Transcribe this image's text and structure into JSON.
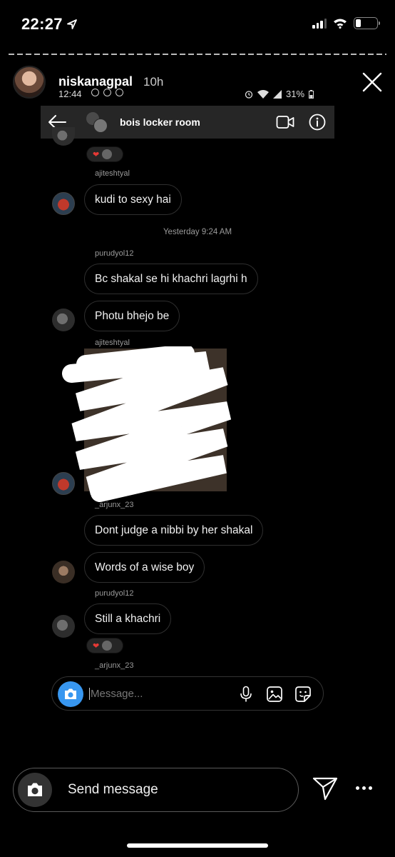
{
  "ios_status": {
    "time": "22:27"
  },
  "story": {
    "username": "niskanagpal",
    "age": "10h"
  },
  "android_status": {
    "time": "12:44",
    "battery": "31%"
  },
  "chat": {
    "title": "bois locker room"
  },
  "messages": [
    {
      "sender": "ajiteshtyal",
      "text": "kudi to sexy hai"
    },
    {
      "timestamp": "Yesterday 9:24 AM"
    },
    {
      "sender": "purudyol12",
      "text": "Bc shakal se hi khachri lagrhi h"
    },
    {
      "text": "Photu bhejo be"
    },
    {
      "sender": "ajiteshtyal",
      "type": "photo"
    },
    {
      "sender": "_arjunx_23",
      "text": "Dont judge a nibbi by her shakal"
    },
    {
      "text": "Words of a wise boy"
    },
    {
      "sender": "purudyol12",
      "text": "Still a khachri"
    },
    {
      "sender": "_arjunx_23"
    }
  ],
  "composer": {
    "placeholder": "Message..."
  },
  "reply_bar": {
    "label": "Send message"
  },
  "colors": {
    "accent": "#3897f0",
    "bubble_border": "#2f2f2f",
    "header_bg": "#262626"
  }
}
